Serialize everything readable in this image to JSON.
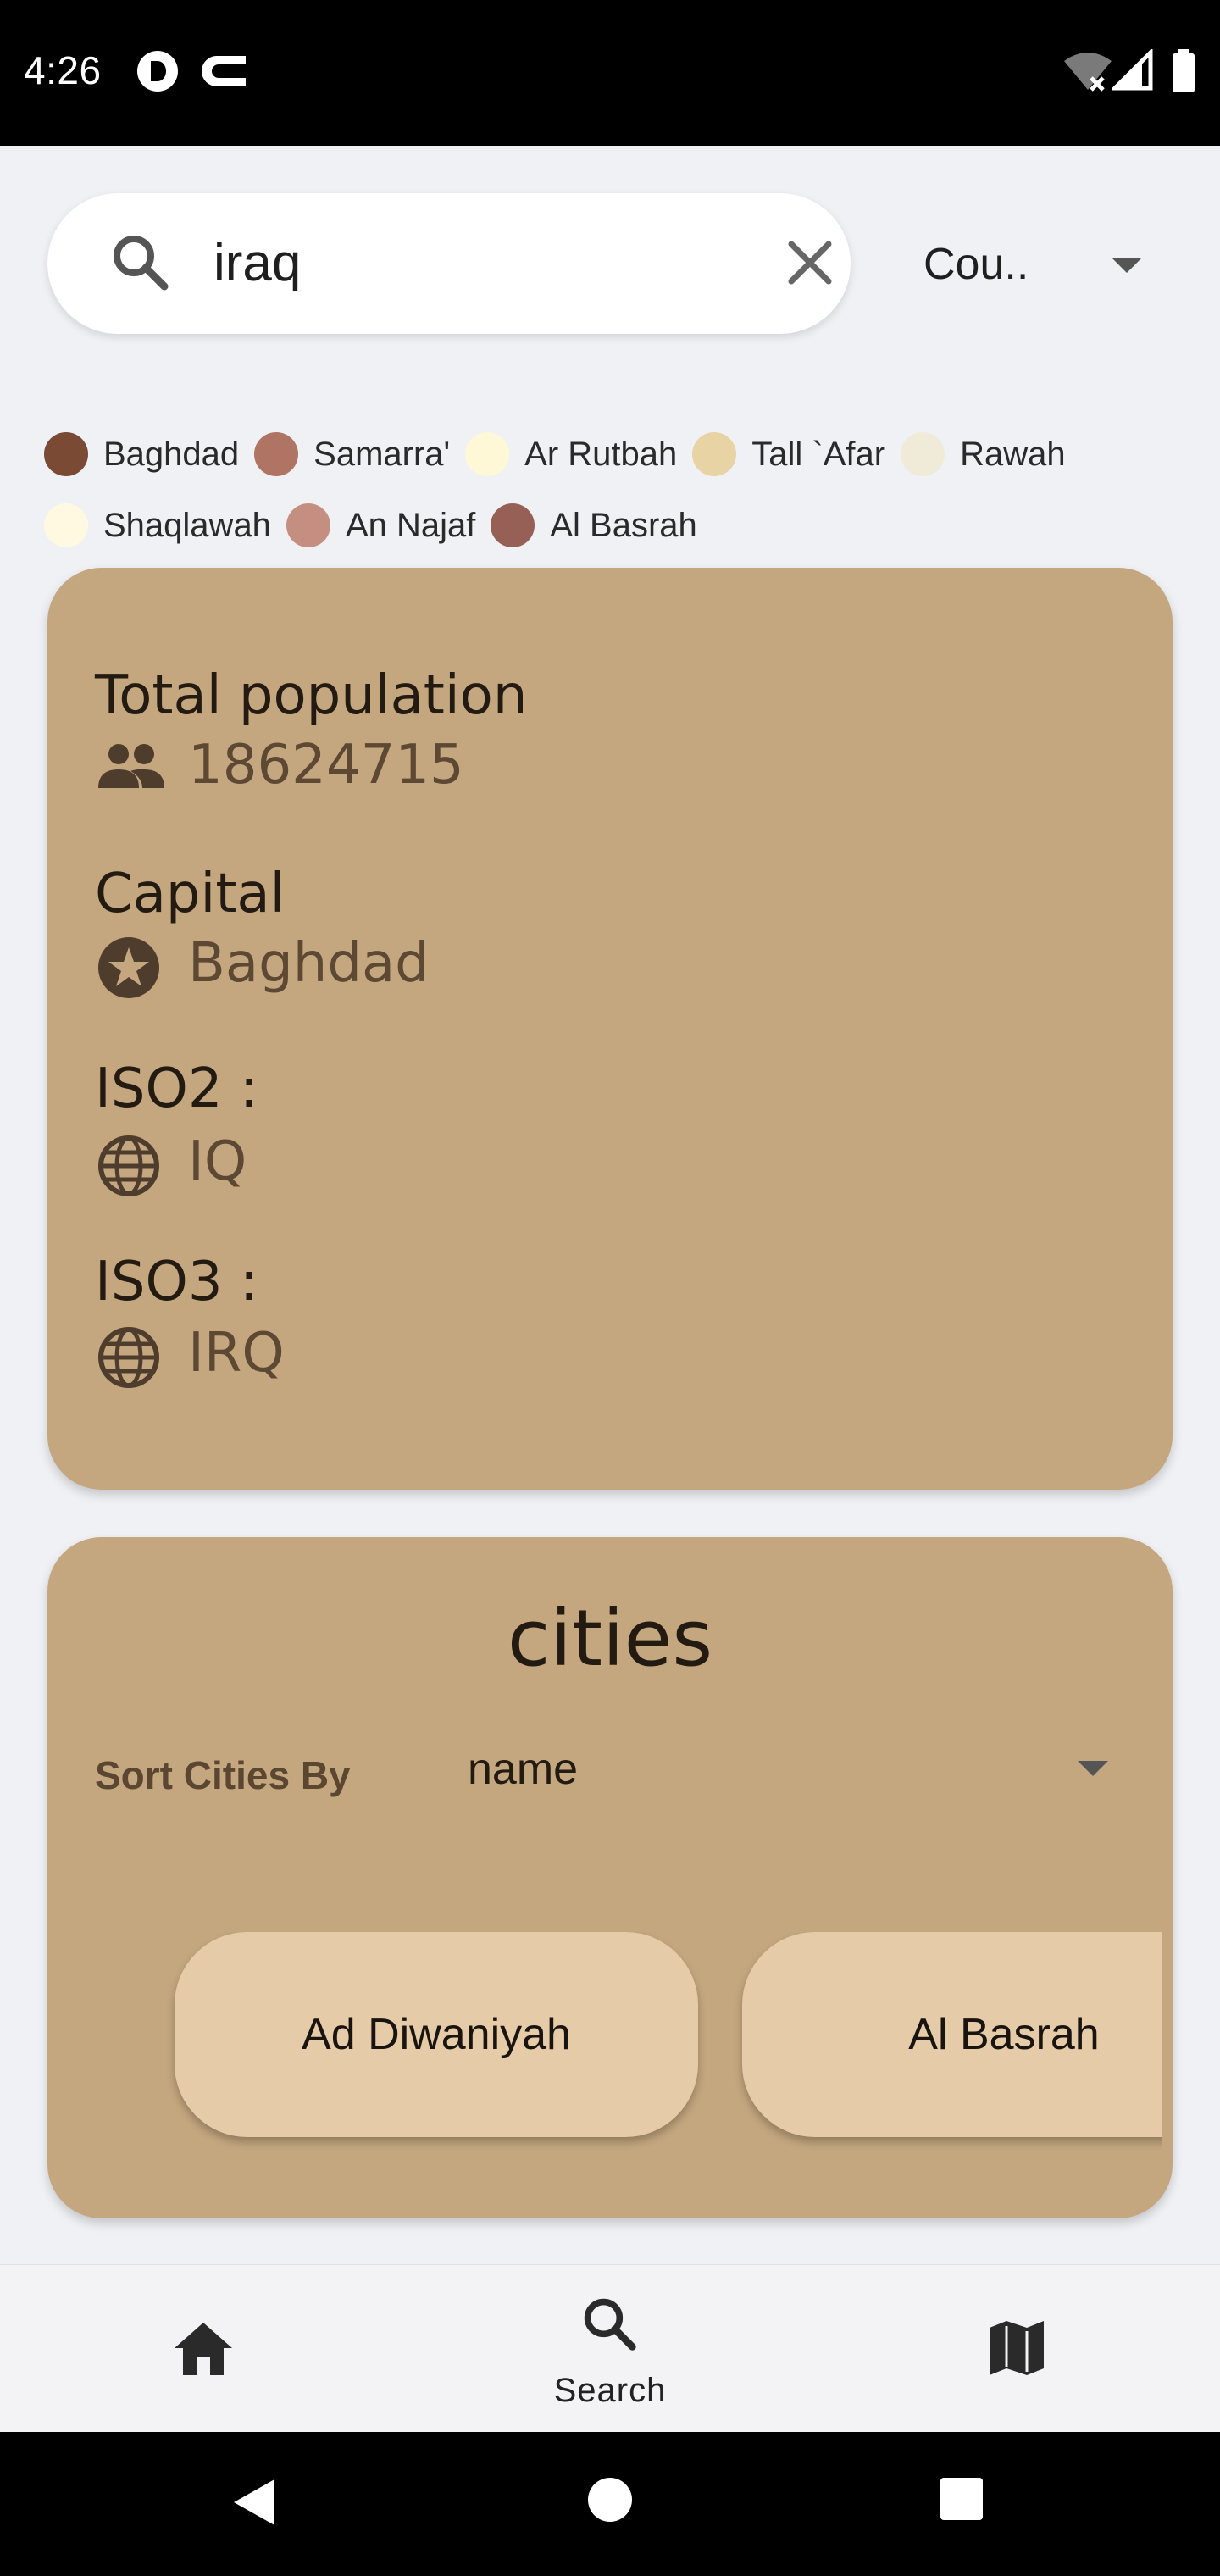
{
  "status_bar": {
    "time": "4:26"
  },
  "search": {
    "value": "iraq",
    "filter_label": "Cou.."
  },
  "legend": [
    {
      "label": "Baghdad",
      "color": "#7a4a35"
    },
    {
      "label": "Samarra'",
      "color": "#b07465"
    },
    {
      "label": "Ar Rutbah",
      "color": "#fff8d6"
    },
    {
      "label": "Tall `Afar",
      "color": "#e7d3a3"
    },
    {
      "label": "Rawah",
      "color": "#efebd8"
    },
    {
      "label": "Shaqlawah",
      "color": "#fff9e2"
    },
    {
      "label": "An Najaf",
      "color": "#c48f80"
    },
    {
      "label": "Al Basrah",
      "color": "#976056"
    }
  ],
  "info": {
    "population_title": "Total population",
    "population_value": "18624715",
    "capital_title": "Capital",
    "capital_value": "Baghdad",
    "iso2_title": "ISO2 :",
    "iso2_value": "IQ",
    "iso3_title": "ISO3 :",
    "iso3_value": "IRQ"
  },
  "cities": {
    "title": "cities",
    "sort_label": "Sort Cities By",
    "sort_value": "name",
    "items": [
      "Ad Diwaniyah",
      "Al Basrah"
    ]
  },
  "bottom_nav": {
    "search_label": "Search"
  },
  "colors": {
    "card": "#c4a77f",
    "chip": "#e5cba7",
    "accent_caret": "#1fbfb0"
  }
}
